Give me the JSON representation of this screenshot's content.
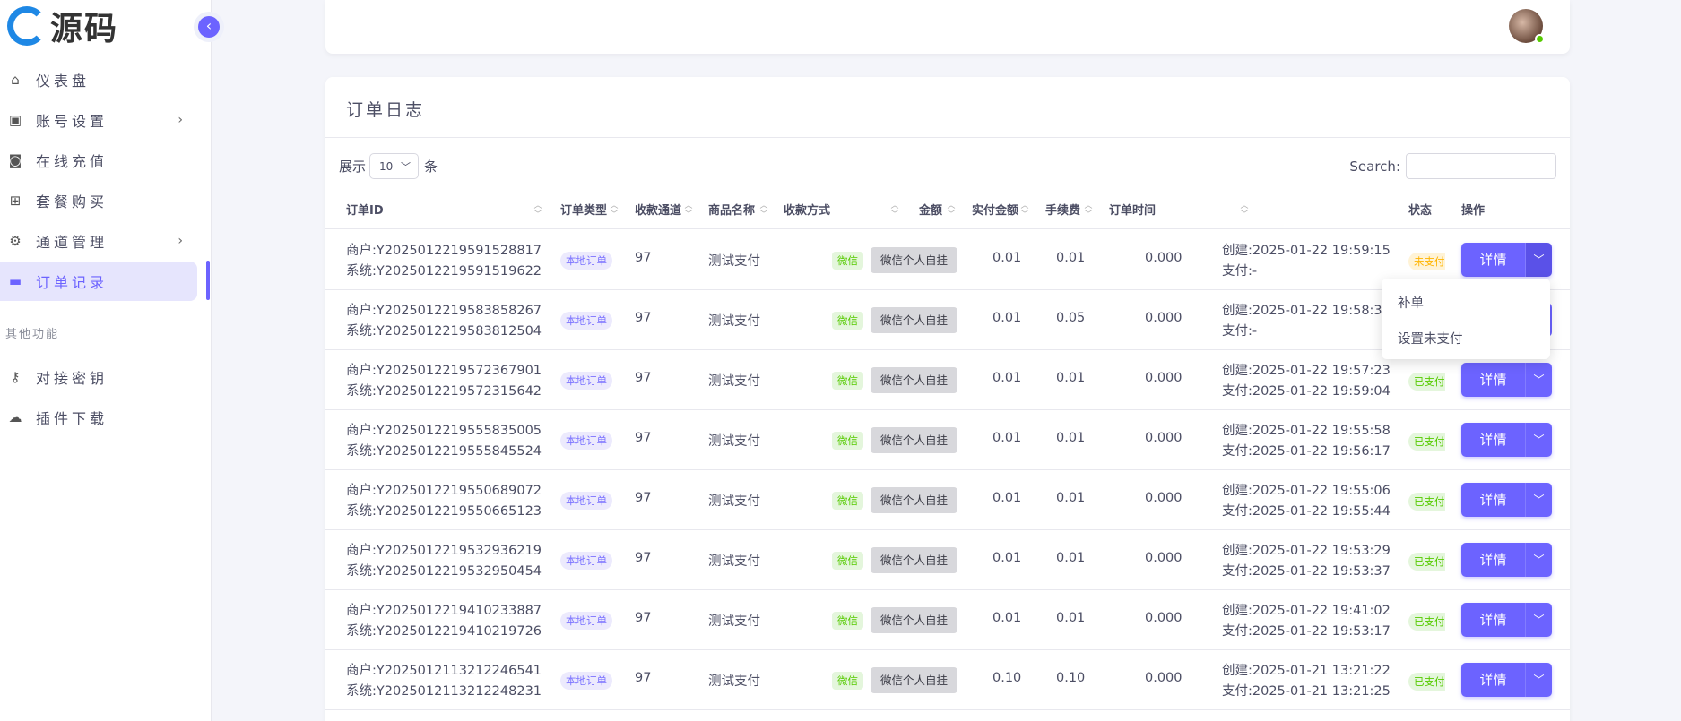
{
  "brand": {
    "logo_text": "源码"
  },
  "sidebar": {
    "items": [
      {
        "label": "仪表盘",
        "icon": "home-icon",
        "has_chevron": false
      },
      {
        "label": "账号设置",
        "icon": "account-icon",
        "has_chevron": true
      },
      {
        "label": "在线充值",
        "icon": "cash-icon",
        "has_chevron": false
      },
      {
        "label": "套餐购买",
        "icon": "shopping-bag-icon",
        "has_chevron": false
      },
      {
        "label": "通道管理",
        "icon": "gear-icon",
        "has_chevron": true
      },
      {
        "label": "订单记录",
        "icon": "wallet-icon",
        "has_chevron": false,
        "active": true
      }
    ],
    "section_label": "其他功能",
    "other_items": [
      {
        "label": "对接密钥",
        "icon": "key-icon"
      },
      {
        "label": "插件下载",
        "icon": "cloud-download-icon"
      }
    ]
  },
  "page": {
    "title": "订单日志",
    "length_prefix": "展示",
    "length_value": "10",
    "length_suffix": "条",
    "search_label": "Search:"
  },
  "table": {
    "columns": [
      "订单ID",
      "订单类型",
      "收款通道",
      "商品名称",
      "收款方式",
      "金额",
      "实付金额",
      "手续费",
      "订单时间",
      "状态",
      "操作"
    ],
    "rows": [
      {
        "merchant_id": "商户:Y2025012219591528817",
        "system_id": "系统:Y2025012219591519622",
        "type": "本地订单",
        "channel": "97",
        "product": "测试支付",
        "pay_method": "微信",
        "pay_channel": "微信个人自挂",
        "amount": "0.01",
        "paid_amount": "0.01",
        "fee": "0.000",
        "created": "创建:2025-01-22 19:59:15",
        "paid": "支付:-",
        "status": "未支付",
        "status_kind": "unpaid",
        "action": "详情"
      },
      {
        "merchant_id": "商户:Y2025012219583858267",
        "system_id": "系统:Y2025012219583812504",
        "type": "本地订单",
        "channel": "97",
        "product": "测试支付",
        "pay_method": "微信",
        "pay_channel": "微信个人自挂",
        "amount": "0.01",
        "paid_amount": "0.05",
        "fee": "0.000",
        "created": "创建:2025-01-22 19:58:39",
        "paid": "支付:-",
        "status": "",
        "status_kind": "none",
        "action": ""
      },
      {
        "merchant_id": "商户:Y2025012219572367901",
        "system_id": "系统:Y2025012219572315642",
        "type": "本地订单",
        "channel": "97",
        "product": "测试支付",
        "pay_method": "微信",
        "pay_channel": "微信个人自挂",
        "amount": "0.01",
        "paid_amount": "0.01",
        "fee": "0.000",
        "created": "创建:2025-01-22 19:57:23",
        "paid": "支付:2025-01-22 19:59:04",
        "status": "已支付",
        "status_kind": "paid",
        "action": "详情"
      },
      {
        "merchant_id": "商户:Y2025012219555835005",
        "system_id": "系统:Y2025012219555845524",
        "type": "本地订单",
        "channel": "97",
        "product": "测试支付",
        "pay_method": "微信",
        "pay_channel": "微信个人自挂",
        "amount": "0.01",
        "paid_amount": "0.01",
        "fee": "0.000",
        "created": "创建:2025-01-22 19:55:58",
        "paid": "支付:2025-01-22 19:56:17",
        "status": "已支付",
        "status_kind": "paid",
        "action": "详情"
      },
      {
        "merchant_id": "商户:Y2025012219550689072",
        "system_id": "系统:Y2025012219550665123",
        "type": "本地订单",
        "channel": "97",
        "product": "测试支付",
        "pay_method": "微信",
        "pay_channel": "微信个人自挂",
        "amount": "0.01",
        "paid_amount": "0.01",
        "fee": "0.000",
        "created": "创建:2025-01-22 19:55:06",
        "paid": "支付:2025-01-22 19:55:44",
        "status": "已支付",
        "status_kind": "paid",
        "action": "详情"
      },
      {
        "merchant_id": "商户:Y2025012219532936219",
        "system_id": "系统:Y2025012219532950454",
        "type": "本地订单",
        "channel": "97",
        "product": "测试支付",
        "pay_method": "微信",
        "pay_channel": "微信个人自挂",
        "amount": "0.01",
        "paid_amount": "0.01",
        "fee": "0.000",
        "created": "创建:2025-01-22 19:53:29",
        "paid": "支付:2025-01-22 19:53:37",
        "status": "已支付",
        "status_kind": "paid",
        "action": "详情"
      },
      {
        "merchant_id": "商户:Y2025012219410233887",
        "system_id": "系统:Y2025012219410219726",
        "type": "本地订单",
        "channel": "97",
        "product": "测试支付",
        "pay_method": "微信",
        "pay_channel": "微信个人自挂",
        "amount": "0.01",
        "paid_amount": "0.01",
        "fee": "0.000",
        "created": "创建:2025-01-22 19:41:02",
        "paid": "支付:2025-01-22 19:53:17",
        "status": "已支付",
        "status_kind": "paid",
        "action": "详情"
      },
      {
        "merchant_id": "商户:Y2025012113212246541",
        "system_id": "系统:Y2025012113212248231",
        "type": "本地订单",
        "channel": "97",
        "product": "测试支付",
        "pay_method": "微信",
        "pay_channel": "微信个人自挂",
        "amount": "0.10",
        "paid_amount": "0.10",
        "fee": "0.000",
        "created": "创建:2025-01-21 13:21:22",
        "paid": "支付:2025-01-21 13:21:25",
        "status": "已支付",
        "status_kind": "paid",
        "action": "详情"
      }
    ]
  },
  "dropdown": {
    "items": [
      "补单",
      "设置未支付"
    ]
  },
  "colors": {
    "accent": "#6c63ff",
    "paid": "#56ca00",
    "unpaid": "#ffb400"
  }
}
